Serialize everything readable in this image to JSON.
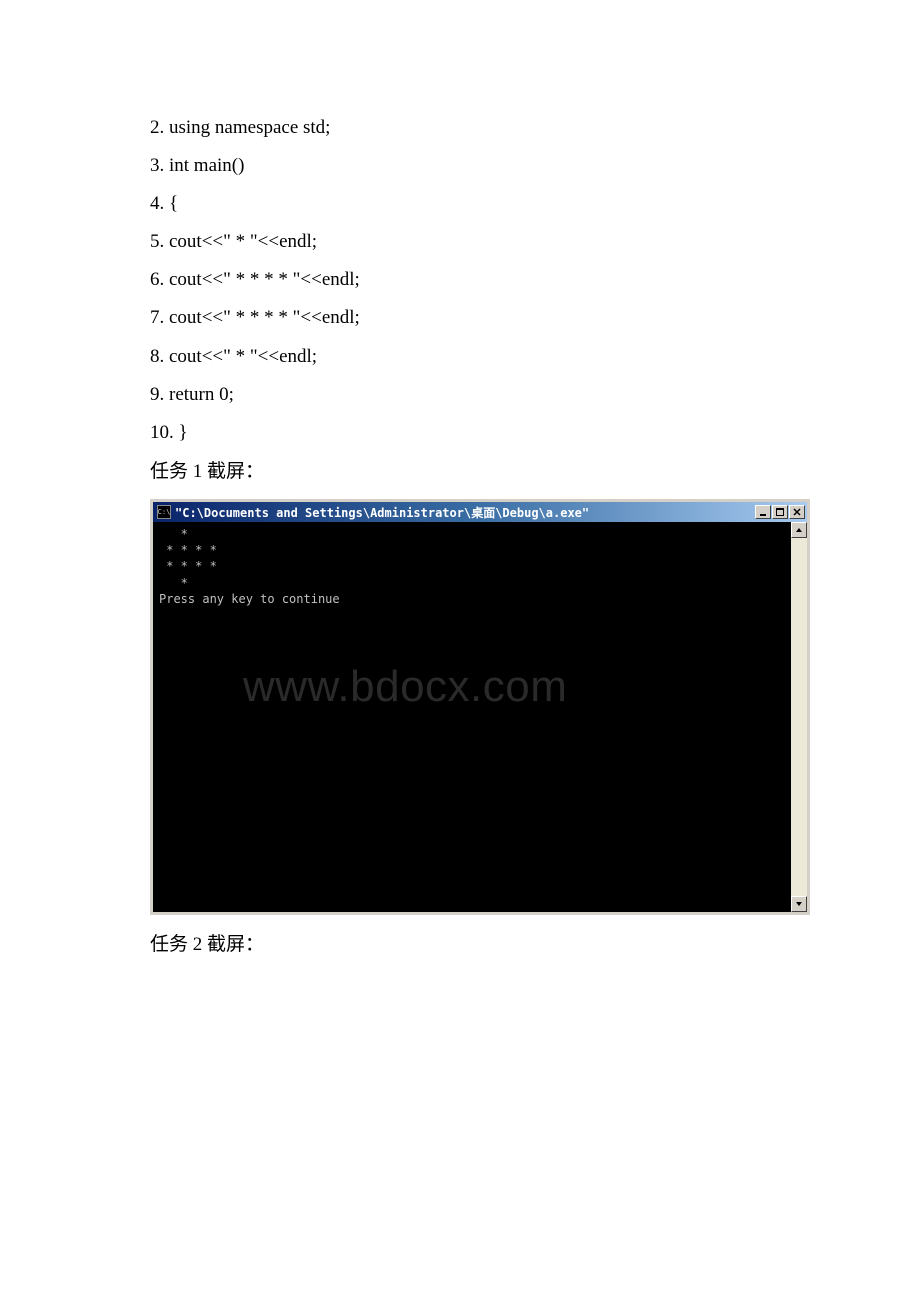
{
  "code": {
    "line2": "2. using namespace std;",
    "line3": "3. int main()",
    "line4": "4. {",
    "line5": "5. cout<<\" * \"<<endl;",
    "line6": "6. cout<<\" * * * * \"<<endl;",
    "line7": "7. cout<<\" * * * * \"<<endl;",
    "line8": "8. cout<<\" * \"<<endl;",
    "line9": "9. return 0;",
    "line10": "10. }"
  },
  "labels": {
    "task1_screenshot": "任务 1 截屏：",
    "task2_screenshot": "任务 2 截屏："
  },
  "console": {
    "title": "\"C:\\Documents and Settings\\Administrator\\桌面\\Debug\\a.exe\"",
    "app_icon_text": "C:\\",
    "output_line1": "   *",
    "output_line2": " * * * *",
    "output_line3": " * * * *",
    "output_line4": "   *",
    "output_prompt": "Press any key to continue"
  },
  "watermark": "www.bdocx.com"
}
